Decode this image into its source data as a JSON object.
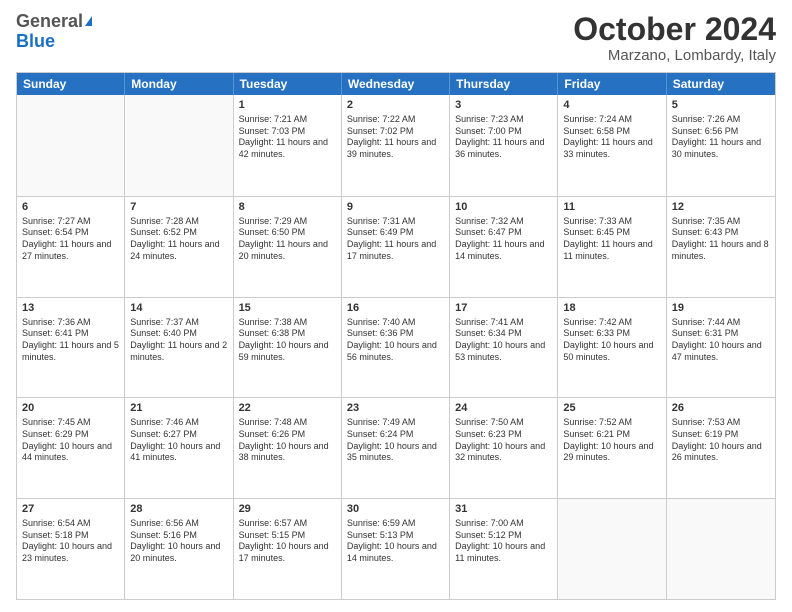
{
  "logo": {
    "general": "General",
    "blue": "Blue"
  },
  "title": {
    "month": "October 2024",
    "location": "Marzano, Lombardy, Italy"
  },
  "weekdays": [
    "Sunday",
    "Monday",
    "Tuesday",
    "Wednesday",
    "Thursday",
    "Friday",
    "Saturday"
  ],
  "weeks": [
    [
      {
        "day": "",
        "info": ""
      },
      {
        "day": "",
        "info": ""
      },
      {
        "day": "1",
        "info": "Sunrise: 7:21 AM\nSunset: 7:03 PM\nDaylight: 11 hours and 42 minutes."
      },
      {
        "day": "2",
        "info": "Sunrise: 7:22 AM\nSunset: 7:02 PM\nDaylight: 11 hours and 39 minutes."
      },
      {
        "day": "3",
        "info": "Sunrise: 7:23 AM\nSunset: 7:00 PM\nDaylight: 11 hours and 36 minutes."
      },
      {
        "day": "4",
        "info": "Sunrise: 7:24 AM\nSunset: 6:58 PM\nDaylight: 11 hours and 33 minutes."
      },
      {
        "day": "5",
        "info": "Sunrise: 7:26 AM\nSunset: 6:56 PM\nDaylight: 11 hours and 30 minutes."
      }
    ],
    [
      {
        "day": "6",
        "info": "Sunrise: 7:27 AM\nSunset: 6:54 PM\nDaylight: 11 hours and 27 minutes."
      },
      {
        "day": "7",
        "info": "Sunrise: 7:28 AM\nSunset: 6:52 PM\nDaylight: 11 hours and 24 minutes."
      },
      {
        "day": "8",
        "info": "Sunrise: 7:29 AM\nSunset: 6:50 PM\nDaylight: 11 hours and 20 minutes."
      },
      {
        "day": "9",
        "info": "Sunrise: 7:31 AM\nSunset: 6:49 PM\nDaylight: 11 hours and 17 minutes."
      },
      {
        "day": "10",
        "info": "Sunrise: 7:32 AM\nSunset: 6:47 PM\nDaylight: 11 hours and 14 minutes."
      },
      {
        "day": "11",
        "info": "Sunrise: 7:33 AM\nSunset: 6:45 PM\nDaylight: 11 hours and 11 minutes."
      },
      {
        "day": "12",
        "info": "Sunrise: 7:35 AM\nSunset: 6:43 PM\nDaylight: 11 hours and 8 minutes."
      }
    ],
    [
      {
        "day": "13",
        "info": "Sunrise: 7:36 AM\nSunset: 6:41 PM\nDaylight: 11 hours and 5 minutes."
      },
      {
        "day": "14",
        "info": "Sunrise: 7:37 AM\nSunset: 6:40 PM\nDaylight: 11 hours and 2 minutes."
      },
      {
        "day": "15",
        "info": "Sunrise: 7:38 AM\nSunset: 6:38 PM\nDaylight: 10 hours and 59 minutes."
      },
      {
        "day": "16",
        "info": "Sunrise: 7:40 AM\nSunset: 6:36 PM\nDaylight: 10 hours and 56 minutes."
      },
      {
        "day": "17",
        "info": "Sunrise: 7:41 AM\nSunset: 6:34 PM\nDaylight: 10 hours and 53 minutes."
      },
      {
        "day": "18",
        "info": "Sunrise: 7:42 AM\nSunset: 6:33 PM\nDaylight: 10 hours and 50 minutes."
      },
      {
        "day": "19",
        "info": "Sunrise: 7:44 AM\nSunset: 6:31 PM\nDaylight: 10 hours and 47 minutes."
      }
    ],
    [
      {
        "day": "20",
        "info": "Sunrise: 7:45 AM\nSunset: 6:29 PM\nDaylight: 10 hours and 44 minutes."
      },
      {
        "day": "21",
        "info": "Sunrise: 7:46 AM\nSunset: 6:27 PM\nDaylight: 10 hours and 41 minutes."
      },
      {
        "day": "22",
        "info": "Sunrise: 7:48 AM\nSunset: 6:26 PM\nDaylight: 10 hours and 38 minutes."
      },
      {
        "day": "23",
        "info": "Sunrise: 7:49 AM\nSunset: 6:24 PM\nDaylight: 10 hours and 35 minutes."
      },
      {
        "day": "24",
        "info": "Sunrise: 7:50 AM\nSunset: 6:23 PM\nDaylight: 10 hours and 32 minutes."
      },
      {
        "day": "25",
        "info": "Sunrise: 7:52 AM\nSunset: 6:21 PM\nDaylight: 10 hours and 29 minutes."
      },
      {
        "day": "26",
        "info": "Sunrise: 7:53 AM\nSunset: 6:19 PM\nDaylight: 10 hours and 26 minutes."
      }
    ],
    [
      {
        "day": "27",
        "info": "Sunrise: 6:54 AM\nSunset: 5:18 PM\nDaylight: 10 hours and 23 minutes."
      },
      {
        "day": "28",
        "info": "Sunrise: 6:56 AM\nSunset: 5:16 PM\nDaylight: 10 hours and 20 minutes."
      },
      {
        "day": "29",
        "info": "Sunrise: 6:57 AM\nSunset: 5:15 PM\nDaylight: 10 hours and 17 minutes."
      },
      {
        "day": "30",
        "info": "Sunrise: 6:59 AM\nSunset: 5:13 PM\nDaylight: 10 hours and 14 minutes."
      },
      {
        "day": "31",
        "info": "Sunrise: 7:00 AM\nSunset: 5:12 PM\nDaylight: 10 hours and 11 minutes."
      },
      {
        "day": "",
        "info": ""
      },
      {
        "day": "",
        "info": ""
      }
    ]
  ]
}
